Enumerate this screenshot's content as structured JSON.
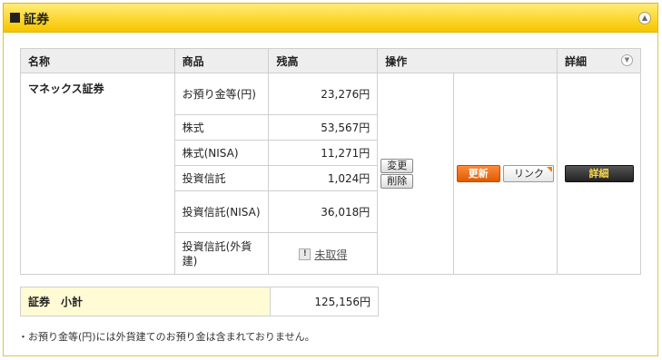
{
  "header": {
    "title": "証券",
    "collapse_icon": "chevron-up-icon"
  },
  "table": {
    "columns": [
      "名称",
      "商品",
      "残高",
      "操作",
      "詳細"
    ],
    "account_name": "マネックス証券",
    "rows": [
      {
        "product": "お預り金等(円)",
        "balance": "23,276円"
      },
      {
        "product": "株式",
        "balance": "53,567円"
      },
      {
        "product": "株式(NISA)",
        "balance": "11,271円"
      },
      {
        "product": "投資信託",
        "balance": "1,024円"
      },
      {
        "product": "投資信託(NISA)",
        "balance": "36,018円"
      },
      {
        "product": "投資信託(外貨建)",
        "balance": "未取得"
      }
    ],
    "operations": {
      "change_label": "変更",
      "delete_label": "削除"
    },
    "update_label": "更新",
    "link_label": "リンク",
    "detail_label": "詳細"
  },
  "subtotal": {
    "label": "証券　小計",
    "value": "125,156円"
  },
  "note": "・お預り金等(円)には外貨建てのお預り金は含まれておりません。",
  "colors": {
    "header_yellow": "#fcd730",
    "update_orange": "#f06a10",
    "detail_black": "#333333",
    "subtotal_bg": "#fffbd5"
  }
}
